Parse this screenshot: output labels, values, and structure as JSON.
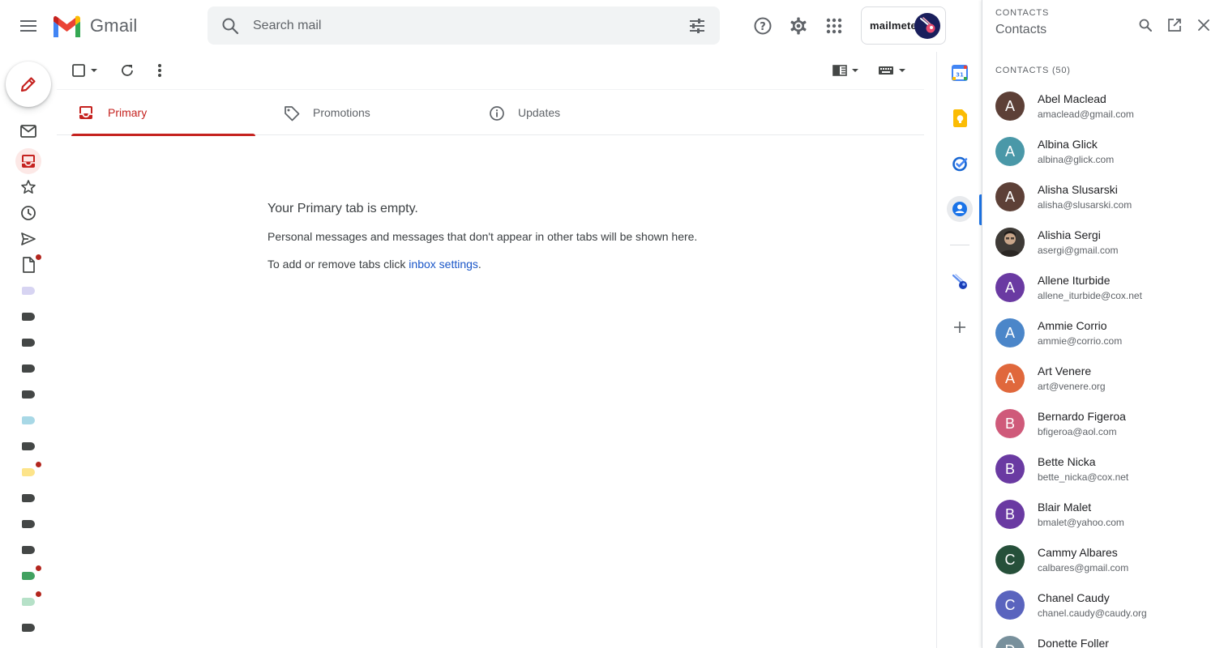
{
  "header": {
    "app_name": "Gmail",
    "search_placeholder": "Search mail",
    "brand_label": "mailmeteor"
  },
  "tabs": [
    {
      "label": "Primary",
      "active": true
    },
    {
      "label": "Promotions",
      "active": false
    },
    {
      "label": "Updates",
      "active": false
    }
  ],
  "empty_state": {
    "title": "Your Primary tab is empty.",
    "line1": "Personal messages and messages that don't appear in other tabs will be shown here.",
    "line2_prefix": "To add or remove tabs click ",
    "line2_link": "inbox settings",
    "line2_suffix": "."
  },
  "nav_labels": [
    {
      "color": "#d7d4f2",
      "dot": false
    },
    {
      "color": "#444746",
      "dot": false
    },
    {
      "color": "#444746",
      "dot": false
    },
    {
      "color": "#444746",
      "dot": false
    },
    {
      "color": "#444746",
      "dot": false
    },
    {
      "color": "#a8d8e6",
      "dot": false
    },
    {
      "color": "#444746",
      "dot": false
    },
    {
      "color": "#fde48a",
      "dot": true
    },
    {
      "color": "#444746",
      "dot": false
    },
    {
      "color": "#444746",
      "dot": false
    },
    {
      "color": "#444746",
      "dot": false
    },
    {
      "color": "#41a160",
      "dot": true
    },
    {
      "color": "#b6e1c8",
      "dot": true
    },
    {
      "color": "#444746",
      "dot": false
    }
  ],
  "panel": {
    "super_title": "CONTACTS",
    "title": "Contacts",
    "list_heading": "CONTACTS (50)"
  },
  "contacts": [
    {
      "name": "Abel Maclead",
      "email": "amaclead@gmail.com",
      "initial": "A",
      "color": "#5d4037"
    },
    {
      "name": "Albina Glick",
      "email": "albina@glick.com",
      "initial": "A",
      "color": "#4a98a8"
    },
    {
      "name": "Alisha Slusarski",
      "email": "alisha@slusarski.com",
      "initial": "A",
      "color": "#5d4037"
    },
    {
      "name": "Alishia Sergi",
      "email": "asergi@gmail.com",
      "initial": "",
      "color": "#3e3a36"
    },
    {
      "name": "Allene Iturbide",
      "email": "allene_iturbide@cox.net",
      "initial": "A",
      "color": "#6a3aa2"
    },
    {
      "name": "Ammie Corrio",
      "email": "ammie@corrio.com",
      "initial": "A",
      "color": "#4b86c9"
    },
    {
      "name": "Art Venere",
      "email": "art@venere.org",
      "initial": "A",
      "color": "#e0683c"
    },
    {
      "name": "Bernardo Figeroa",
      "email": "bfigeroa@aol.com",
      "initial": "B",
      "color": "#cf5a7a"
    },
    {
      "name": "Bette Nicka",
      "email": "bette_nicka@cox.net",
      "initial": "B",
      "color": "#6a3aa2"
    },
    {
      "name": "Blair Malet",
      "email": "bmalet@yahoo.com",
      "initial": "B",
      "color": "#6a3aa2"
    },
    {
      "name": "Cammy Albares",
      "email": "calbares@gmail.com",
      "initial": "C",
      "color": "#26503a"
    },
    {
      "name": "Chanel Caudy",
      "email": "chanel.caudy@caudy.org",
      "initial": "C",
      "color": "#5a64be"
    },
    {
      "name": "Donette Foller",
      "email": "",
      "initial": "D",
      "color": "#78909c"
    }
  ],
  "colors": {
    "accent_red": "#c5221f",
    "link_blue": "#1a56c8",
    "search_bg": "#f1f3f4"
  }
}
